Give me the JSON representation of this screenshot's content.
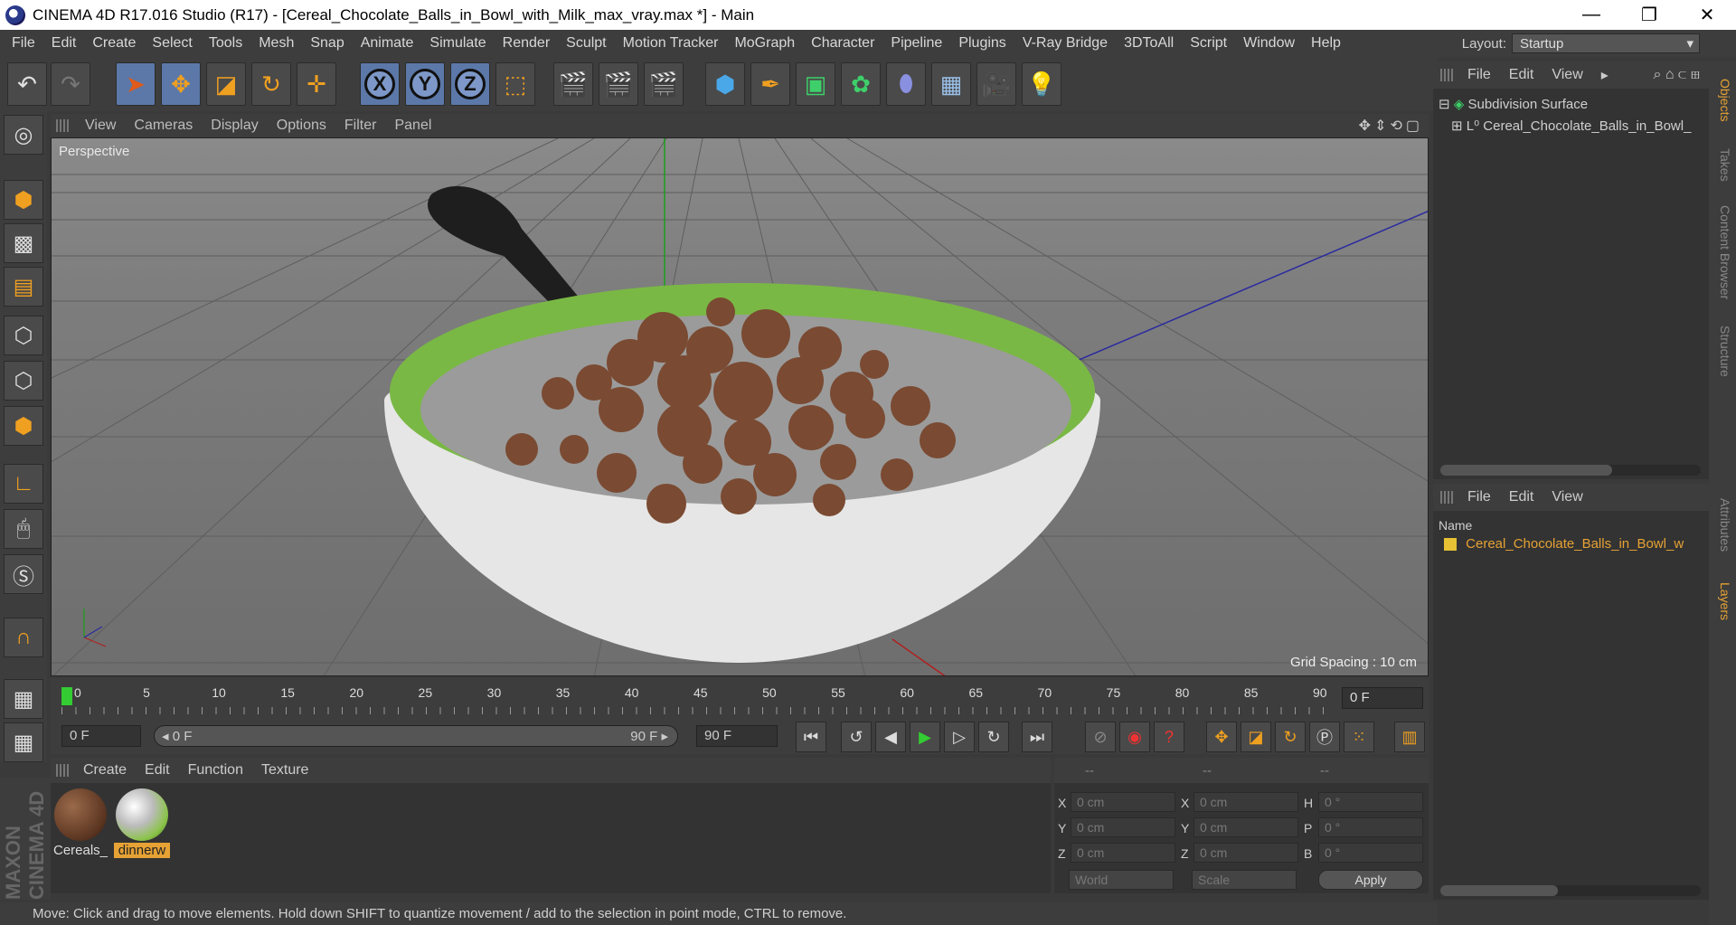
{
  "window": {
    "title": "CINEMA 4D R17.016 Studio (R17) - [Cereal_Chocolate_Balls_in_Bowl_with_Milk_max_vray.max *] - Main",
    "controls": [
      "—",
      "❐",
      "✕"
    ]
  },
  "menubar": {
    "items": [
      "File",
      "Edit",
      "Create",
      "Select",
      "Tools",
      "Mesh",
      "Snap",
      "Animate",
      "Simulate",
      "Render",
      "Sculpt",
      "Motion Tracker",
      "MoGraph",
      "Character",
      "Pipeline",
      "Plugins",
      "V-Ray Bridge",
      "3DToAll",
      "Script",
      "Window",
      "Help"
    ],
    "layout_label": "Layout:",
    "layout_value": "Startup"
  },
  "toolbar": {
    "axis_x": "X",
    "axis_y": "Y",
    "axis_z": "Z"
  },
  "viewport": {
    "menu": [
      "View",
      "Cameras",
      "Display",
      "Options",
      "Filter",
      "Panel"
    ],
    "label": "Perspective",
    "grid_spacing": "Grid Spacing : 10 cm"
  },
  "timeline": {
    "ticks": [
      "0",
      "5",
      "10",
      "15",
      "20",
      "25",
      "30",
      "35",
      "40",
      "45",
      "50",
      "55",
      "60",
      "65",
      "70",
      "75",
      "80",
      "85",
      "90"
    ],
    "current_frame": "0 F"
  },
  "transport": {
    "start_field": "0 F",
    "slider_left": "◂ 0 F",
    "slider_right": "90 F ▸",
    "end_field": "90 F"
  },
  "materials": {
    "menu": [
      "Create",
      "Edit",
      "Function",
      "Texture"
    ],
    "items": [
      {
        "label": "Cereals_",
        "selected": false,
        "color": "#6b4530"
      },
      {
        "label": "dinnerw",
        "selected": true,
        "color": "#8bc34a"
      }
    ]
  },
  "coordinates": {
    "header": [
      "--",
      "--",
      "--"
    ],
    "rows": [
      {
        "a": "X",
        "av": "0 cm",
        "b": "X",
        "bv": "0 cm",
        "c": "H",
        "cv": "0 °"
      },
      {
        "a": "Y",
        "av": "0 cm",
        "b": "Y",
        "bv": "0 cm",
        "c": "P",
        "cv": "0 °"
      },
      {
        "a": "Z",
        "av": "0 cm",
        "b": "Z",
        "bv": "0 cm",
        "c": "B",
        "cv": "0 °"
      }
    ],
    "mode1": "World",
    "mode2": "Scale",
    "apply": "Apply"
  },
  "objects": {
    "menu": [
      "File",
      "Edit",
      "View"
    ],
    "tree": [
      {
        "label": "Subdivision Surface",
        "level": 0
      },
      {
        "label": "Cereal_Chocolate_Balls_in_Bowl_",
        "level": 1
      }
    ]
  },
  "attributes": {
    "menu": [
      "File",
      "Edit",
      "View"
    ],
    "column": "Name",
    "layer": "Cereal_Chocolate_Balls_in_Bowl_w"
  },
  "side_tabs": [
    {
      "label": "Objects",
      "active": true
    },
    {
      "label": "Takes",
      "active": false
    },
    {
      "label": "Content Browser",
      "active": false
    },
    {
      "label": "Structure",
      "active": false
    },
    {
      "label": "Attributes",
      "active": false
    },
    {
      "label": "Layers",
      "active": true
    }
  ],
  "status": "Move: Click and drag to move elements. Hold down SHIFT to quantize movement / add to the selection in point mode, CTRL to remove.",
  "brand": "MAXON CINEMA 4D",
  "colors": {
    "accent": "#e6a234",
    "selection_blue": "#5b78a8",
    "viewport_bg": "#7d7d7d"
  }
}
